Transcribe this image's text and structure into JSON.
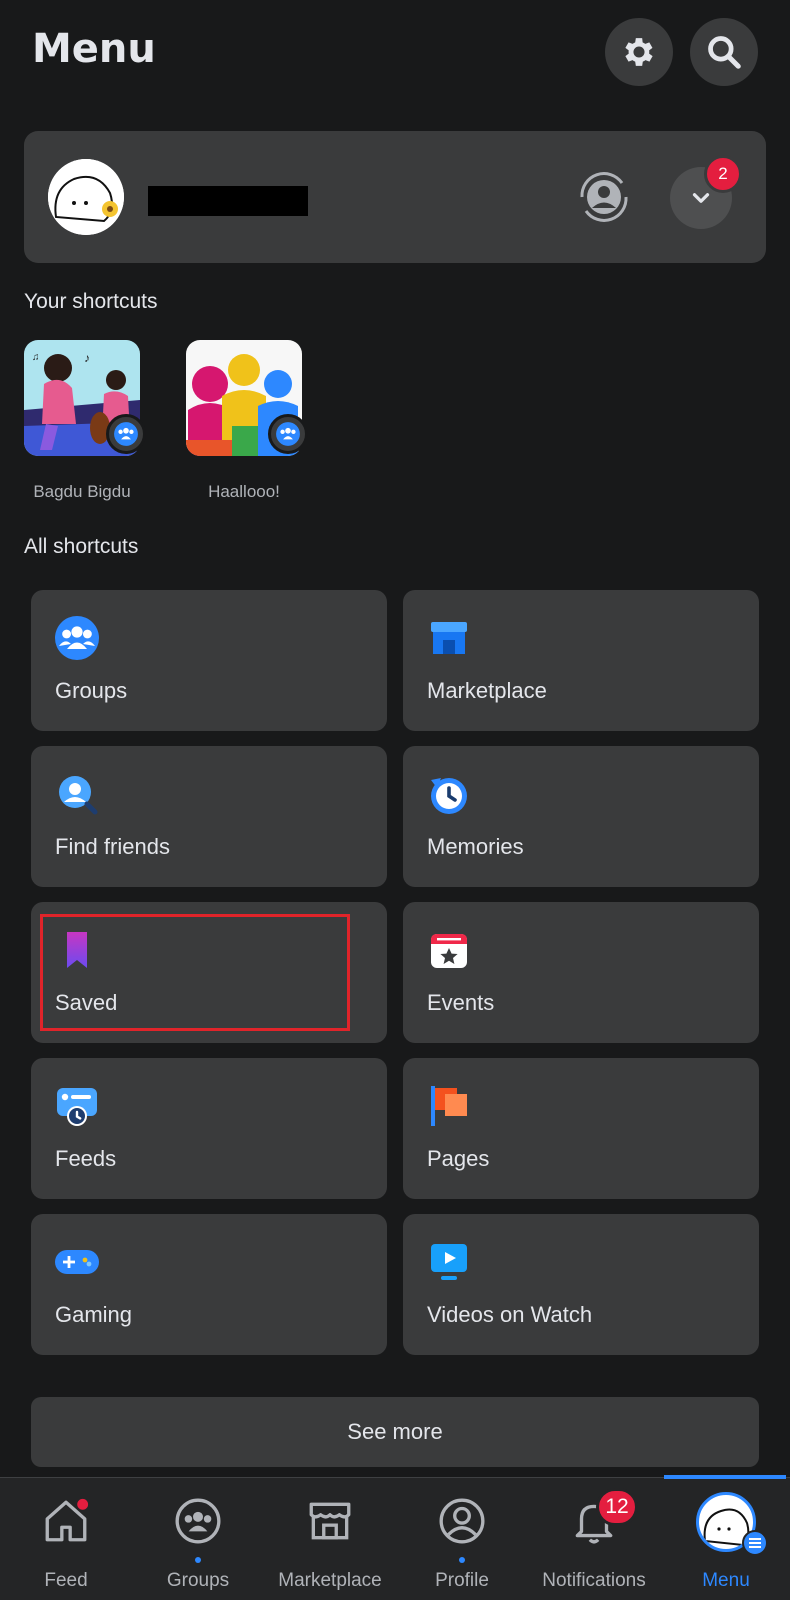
{
  "header": {
    "title": "Menu"
  },
  "profile": {
    "notification_count": "2"
  },
  "your_shortcuts": {
    "label": "Your shortcuts",
    "items": [
      {
        "name": "Bagdu Bigdu"
      },
      {
        "name": "Haallooo!"
      }
    ]
  },
  "all_shortcuts": {
    "label": "All shortcuts",
    "tiles": [
      {
        "label": "Groups",
        "icon": "groups-icon"
      },
      {
        "label": "Marketplace",
        "icon": "marketplace-icon"
      },
      {
        "label": "Find friends",
        "icon": "find-friends-icon"
      },
      {
        "label": "Memories",
        "icon": "memories-icon"
      },
      {
        "label": "Saved",
        "icon": "saved-icon"
      },
      {
        "label": "Events",
        "icon": "events-icon"
      },
      {
        "label": "Feeds",
        "icon": "feeds-icon"
      },
      {
        "label": "Pages",
        "icon": "pages-icon"
      },
      {
        "label": "Gaming",
        "icon": "gaming-icon"
      },
      {
        "label": "Videos on Watch",
        "icon": "videos-on-watch-icon"
      }
    ]
  },
  "see_more": "See more",
  "bottom_nav": {
    "items": [
      {
        "label": "Feed"
      },
      {
        "label": "Groups"
      },
      {
        "label": "Marketplace"
      },
      {
        "label": "Profile"
      },
      {
        "label": "Notifications",
        "badge": "12"
      },
      {
        "label": "Menu"
      }
    ],
    "active": "Menu"
  },
  "colors": {
    "background": "#18191a",
    "card": "#3a3b3c",
    "accent": "#2d88ff",
    "badge": "#e41e3f",
    "highlight": "#e0242a"
  }
}
